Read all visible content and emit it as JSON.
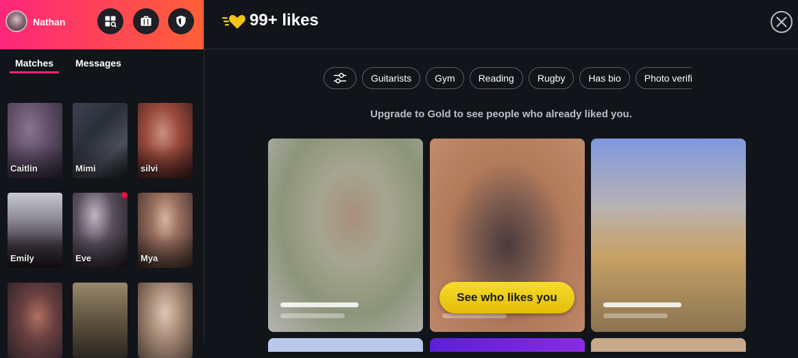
{
  "user": {
    "name": "Nathan"
  },
  "header_buttons": [
    {
      "icon": "explore-icon"
    },
    {
      "icon": "briefcase-icon"
    },
    {
      "icon": "shield-icon"
    }
  ],
  "tabs": [
    {
      "label": "Matches",
      "active": true
    },
    {
      "label": "Messages",
      "active": false
    }
  ],
  "matches": [
    {
      "name": "Caitlin",
      "unread": false
    },
    {
      "name": "Mimi",
      "unread": false
    },
    {
      "name": "silvi",
      "unread": false
    },
    {
      "name": "Emily",
      "unread": false
    },
    {
      "name": "Eve",
      "unread": true
    },
    {
      "name": "Mya",
      "unread": false
    },
    {
      "name": "",
      "unread": false
    },
    {
      "name": "",
      "unread": false
    },
    {
      "name": "",
      "unread": false
    }
  ],
  "likes": {
    "title": "99+ likes"
  },
  "filters": [
    "Guitarists",
    "Gym",
    "Reading",
    "Rugby",
    "Has bio",
    "Photo verified"
  ],
  "upgrade_text": "Upgrade to Gold to see people who already liked you.",
  "cta_label": "See who likes you",
  "colors": {
    "brand_gradient_start": "#fd267a",
    "brand_gradient_end": "#ff6036",
    "gold": "#f5dc2a",
    "background": "#111418"
  }
}
